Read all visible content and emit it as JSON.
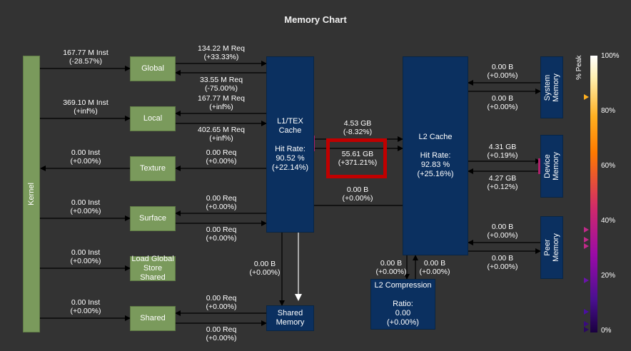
{
  "title": "Memory Chart",
  "kernel": "Kernel",
  "units": {
    "global": "Global",
    "local": "Local",
    "texture": "Texture",
    "surface": "Surface",
    "load_global": "Load Global\nStore Shared",
    "shared": "Shared",
    "l1": "L1/TEX\nCache\n\nHit Rate:\n90.52 %\n(+22.14%)",
    "l2": "L2 Cache\n\nHit Rate:\n92.83 %\n(+25.16%)",
    "shared_memory": "Shared\nMemory",
    "l2_compression": "L2 Compression\n\nRatio:\n0.00\n(+0.00%)",
    "system_memory": "System\nMemory",
    "device_memory": "Device\nMemory",
    "peer_memory": "Peer\nMemory"
  },
  "labels": {
    "global_inst": "167.77 M Inst\n(-28.57%)",
    "local_inst": "369.10 M Inst\n(+inf%)",
    "texture_inst": "0.00 Inst\n(+0.00%)",
    "surface_inst": "0.00 Inst\n(+0.00%)",
    "ldgst_inst": "0.00 Inst\n(+0.00%)",
    "shared_inst": "0.00 Inst\n(+0.00%)",
    "global_req": "134.22 M Req\n(+33.33%)",
    "global_req2": "33.55 M Req\n(-75.00%)",
    "local_req": "167.77 M Req\n(+inf%)",
    "local_req2": "402.65 M Req\n(+inf%)",
    "texture_req": "0.00 Req\n(+0.00%)",
    "surface_req": "0.00 Req\n(+0.00%)",
    "surface_req2": "0.00 Req\n(+0.00%)",
    "shared_req": "0.00 Req\n(+0.00%)",
    "shared_req2": "0.00 Req\n(+0.00%)",
    "l1_shared_b": "0.00 B\n(+0.00%)",
    "l1_l2_top": "4.53 GB\n(-8.32%)",
    "l1_l2_mid": "55.61 GB\n(+371.21%)",
    "l1_l2_bot": "0.00 B\n(+0.00%)",
    "comp_left": "0.00 B\n(+0.00%)",
    "comp_right": "0.00 B\n(+0.00%)",
    "sys_top": "0.00 B\n(+0.00%)",
    "sys_bot": "0.00 B\n(+0.00%)",
    "dev_top": "4.31 GB\n(+0.19%)",
    "dev_bot": "4.27 GB\n(+0.12%)",
    "peer_top": "0.00 B\n(+0.00%)",
    "peer_bot": "0.00 B\n(+0.00%)"
  },
  "legend": {
    "title": "% Peak",
    "ticks": [
      "100%",
      "80%",
      "60%",
      "40%",
      "20%",
      "0%"
    ]
  },
  "colors": {
    "background": "#333333",
    "unit_green": "#7a9a5c",
    "cache_blue": "#0b3060",
    "highlight_red": "#c00000",
    "l2_port_orange": "#f5a623",
    "port_magenta": "#b0206a"
  }
}
